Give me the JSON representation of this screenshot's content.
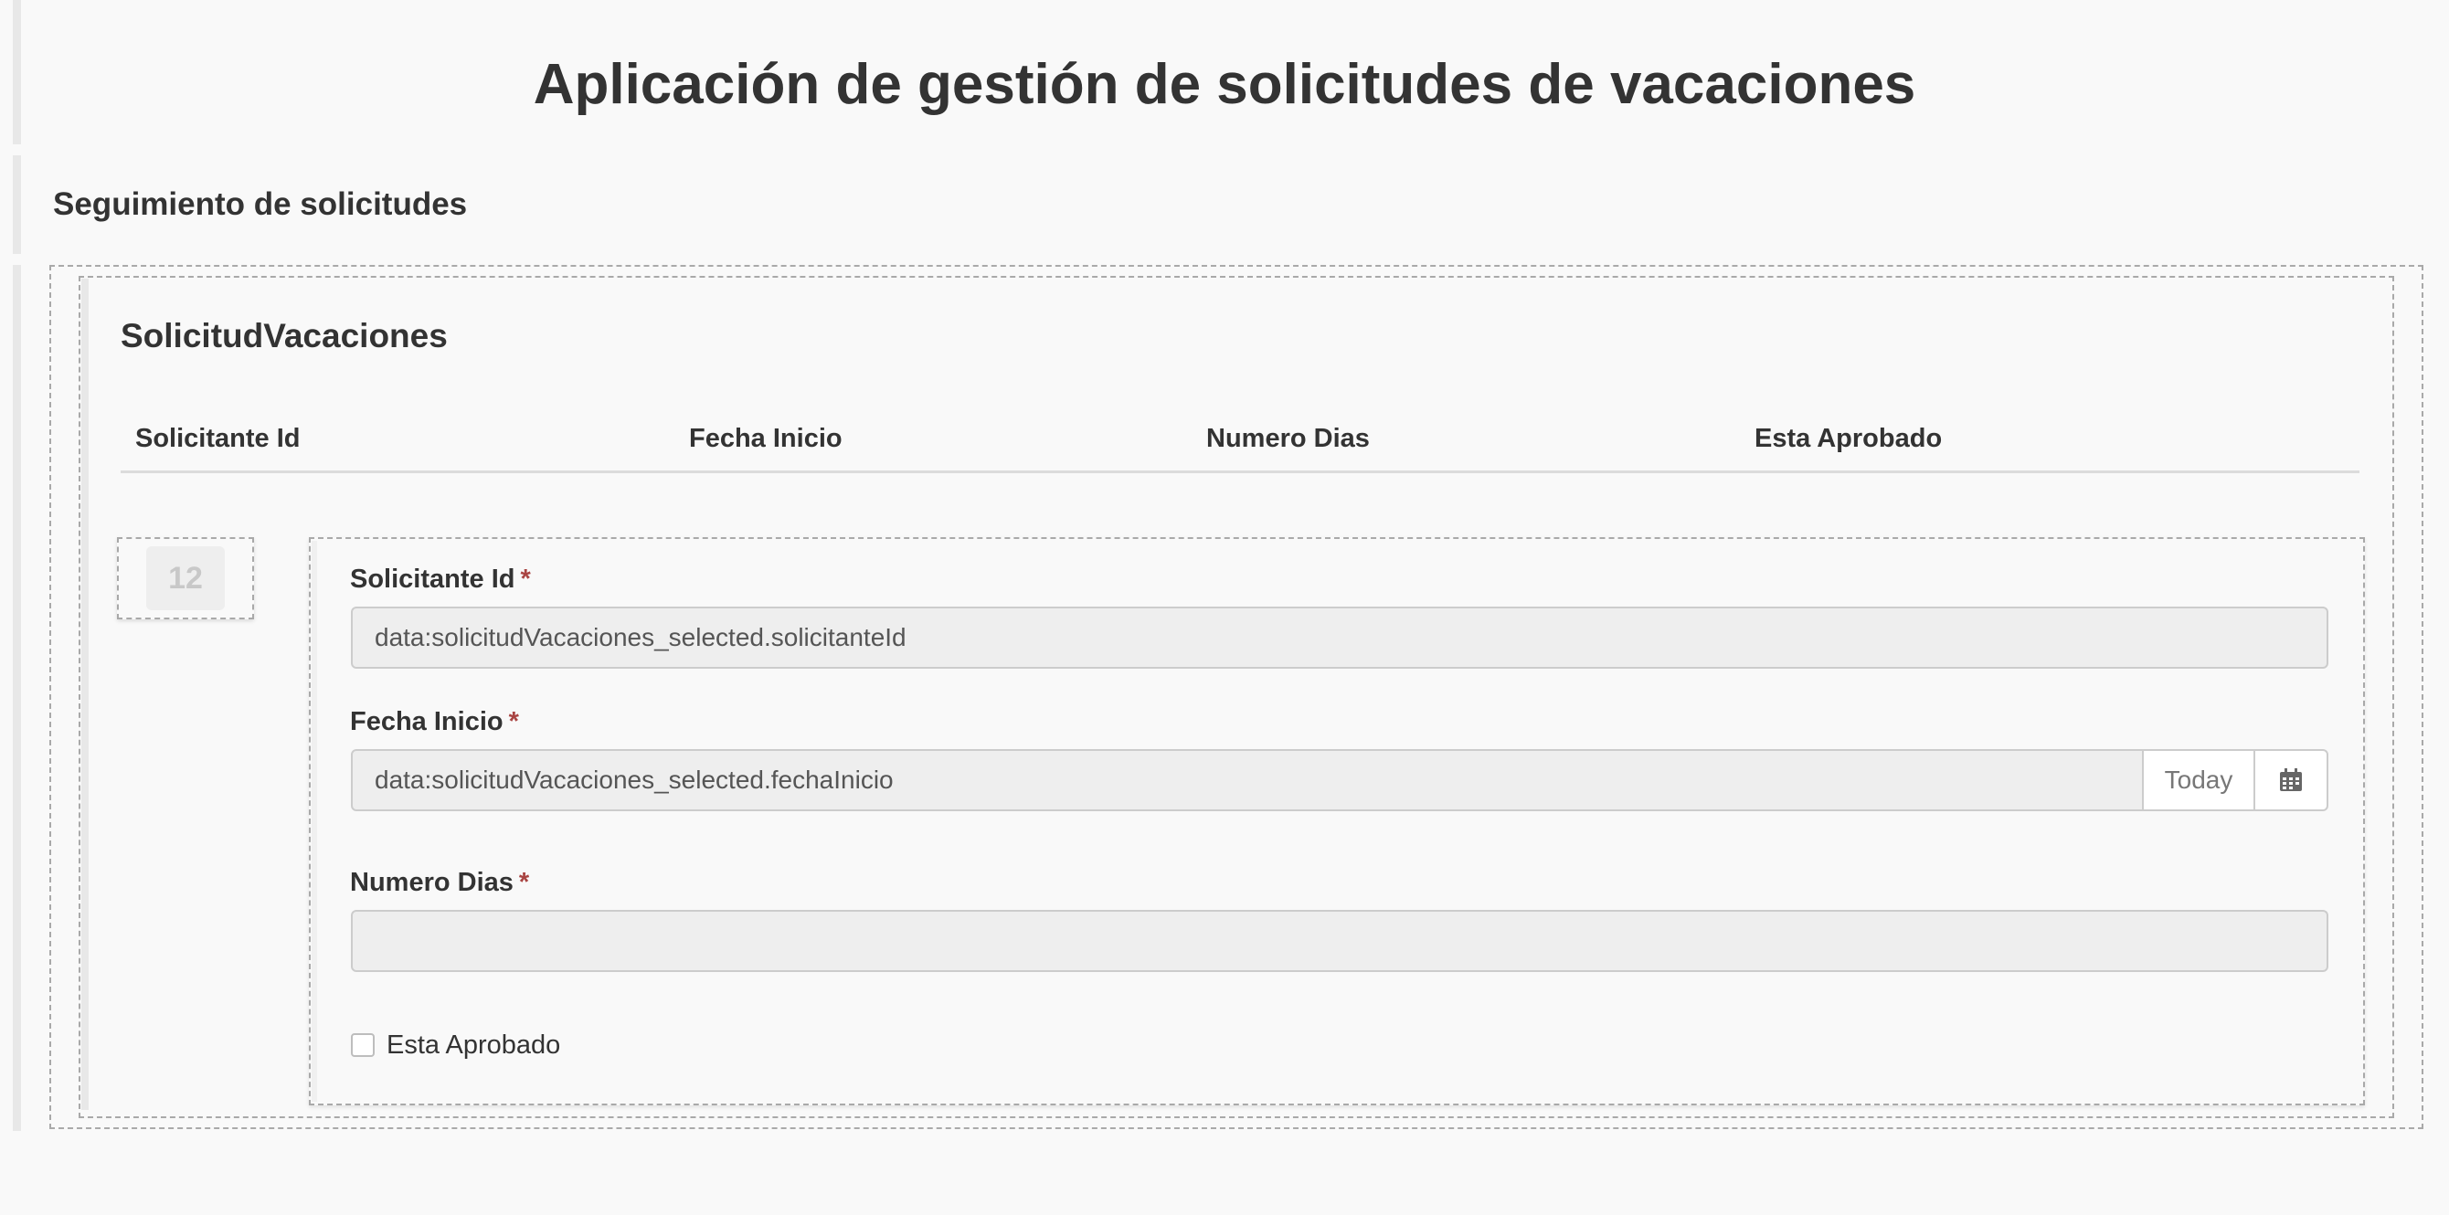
{
  "app": {
    "title": "Aplicación de gestión de solicitudes de vacaciones"
  },
  "section": {
    "title": "Seguimiento de solicitudes"
  },
  "entity": {
    "title": "SolicitudVacaciones",
    "columns": [
      "Solicitante Id",
      "Fecha Inicio",
      "Numero Dias",
      "Esta Aprobado"
    ]
  },
  "row": {
    "number": "12"
  },
  "form": {
    "required_marker": "*",
    "solicitante_id": {
      "label": "Solicitante Id",
      "value": "data:solicitudVacaciones_selected.solicitanteId"
    },
    "fecha_inicio": {
      "label": "Fecha Inicio",
      "value": "data:solicitudVacaciones_selected.fechaInicio",
      "today_label": "Today",
      "calendar_icon": "calendar-icon"
    },
    "numero_dias": {
      "label": "Numero Dias",
      "value": ""
    },
    "esta_aprobado": {
      "label": "Esta Aprobado",
      "checked": false
    }
  },
  "colors": {
    "background": "#f9f9f9",
    "text": "#333333",
    "required": "#a94442",
    "input_background": "#eeeeee",
    "border": "#cccccc"
  }
}
